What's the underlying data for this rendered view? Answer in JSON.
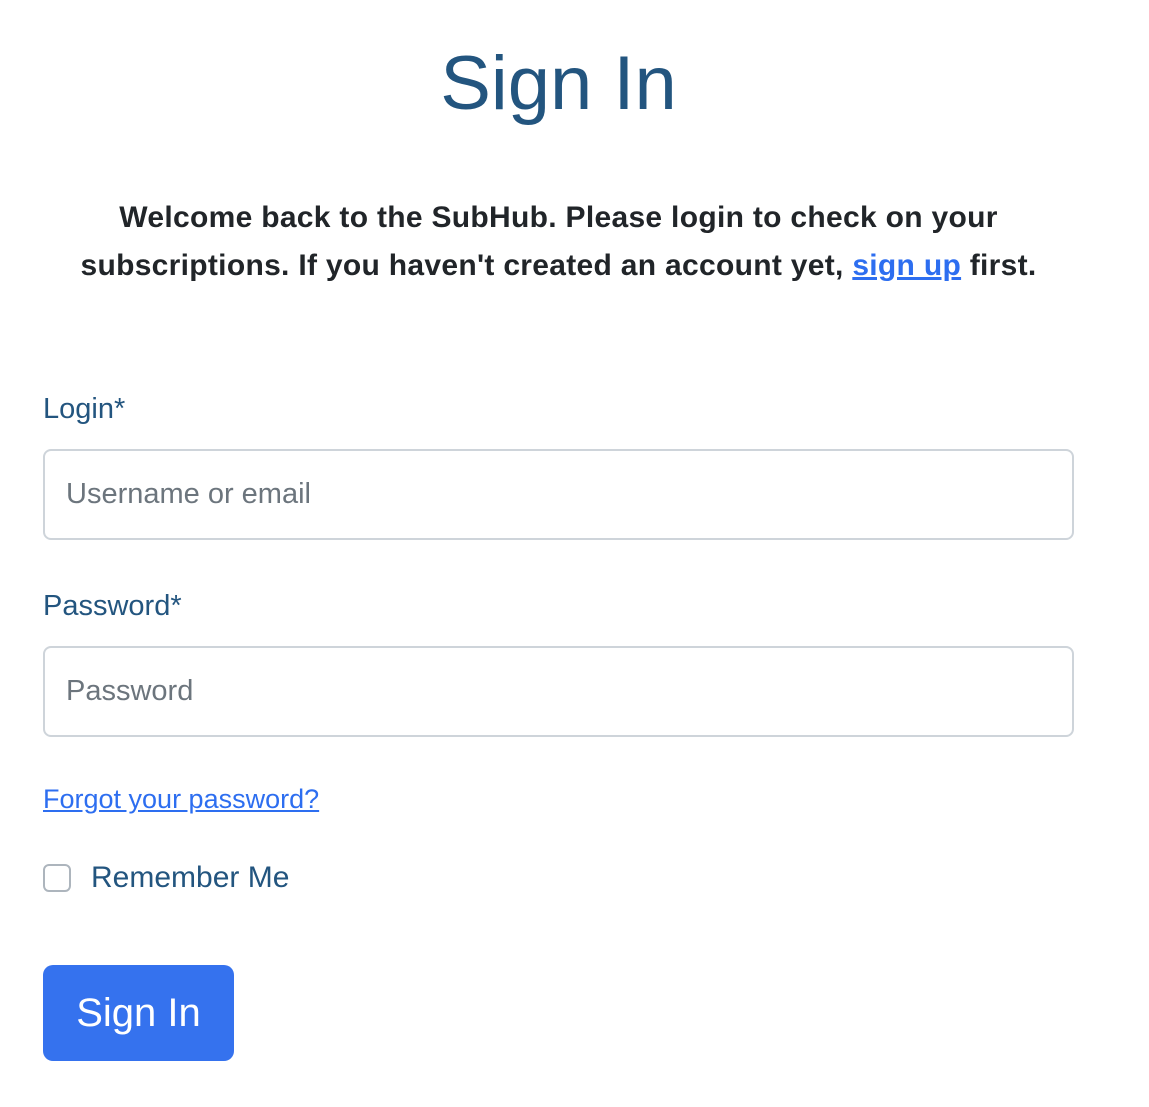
{
  "page": {
    "title": "Sign In"
  },
  "intro": {
    "text_before": "Welcome back to the SubHub. Please login to check on your subscriptions. If you haven't created an account yet, ",
    "signup_link": "sign up",
    "text_after": " first."
  },
  "form": {
    "login_label": "Login*",
    "login_placeholder": "Username or email",
    "password_label": "Password*",
    "password_placeholder": "Password",
    "forgot_link": "Forgot your password?",
    "remember_label": "Remember Me",
    "remember_checked": false,
    "submit_label": "Sign In"
  },
  "colors": {
    "heading": "#23557f",
    "link": "#2d6ef0",
    "primary_button": "#3572ee"
  }
}
